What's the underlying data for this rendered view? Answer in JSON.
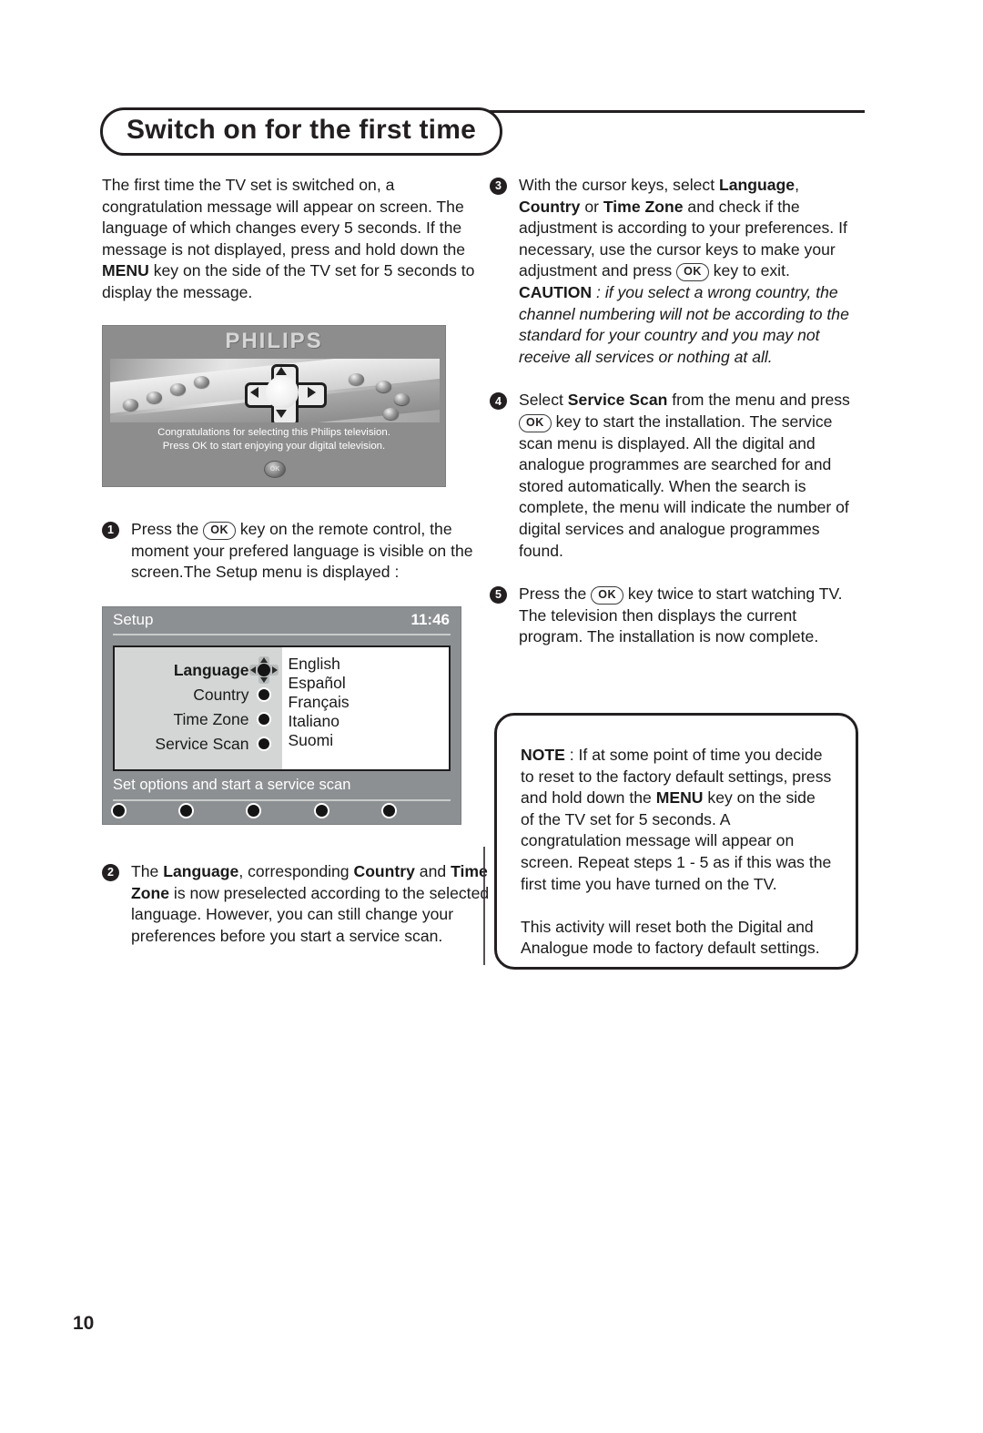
{
  "page": {
    "title": "Switch on for the first time",
    "number": "10"
  },
  "left_column": {
    "intro": "The first time the TV set is switched on, a congratulation message will appear on screen. The language of which changes every 5 seconds. If the message is not displayed, press and hold down the MENU key on the side of the TV set for 5 seconds to display the message.",
    "intro_parts": {
      "p1": "The first time the TV set is switched on, a congratulation message will appear on screen. The language of which changes every 5 seconds. If the message is not displayed, press and hold down the ",
      "menu_bold": "MENU",
      "p2": " key on the side of the TV set for 5 seconds to display the message."
    },
    "tv_image": {
      "brand": "PHILIPS",
      "message_line1": "Congratulations for selecting this Philips television.",
      "message_line2": "Press OK to start enjoying your digital television.",
      "ok_badge": "OK"
    },
    "step1": {
      "number": "1",
      "text_before": "Press the ",
      "ok_key": "OK",
      "text_after": " key on the remote control, the moment your prefered language is visible on the screen.The Setup menu is displayed :"
    },
    "setup_menu": {
      "title": "Setup",
      "time": "11:46",
      "items": [
        {
          "label": "Language",
          "selected": true
        },
        {
          "label": "Country",
          "selected": false
        },
        {
          "label": "Time Zone",
          "selected": false
        },
        {
          "label": "Service Scan",
          "selected": false
        }
      ],
      "languages": [
        "English",
        "Español",
        "Français",
        "Italiano",
        "Suomi"
      ],
      "footer_text": "Set options and start a service scan",
      "footer_dots": 5
    },
    "step2": {
      "number": "2",
      "seg1": "The ",
      "bold1": "Language",
      "seg2": ", corresponding ",
      "bold2": "Country",
      "seg3": " and ",
      "bold3": "Time Zone",
      "seg4": " is now preselected according to the selected language. However, you can still change your preferences before you start a service scan."
    }
  },
  "right_column": {
    "step3": {
      "number": "3",
      "seg1": "With the cursor keys, select ",
      "bold1": "Language",
      "seg2": ", ",
      "bold2": "Country",
      "seg3": " or ",
      "bold3": "Time Zone",
      "seg4": " and check if the adjustment is according to your preferences. If necessary, use the cursor keys to make your adjustment and press ",
      "ok_key": "OK",
      "seg5": " key to exit.",
      "caution_label": "CAUTION",
      "caution_text": " : if you select a wrong country, the channel numbering will not be according to the standard for your country and you may not receive all services or nothing at all."
    },
    "step4": {
      "number": "4",
      "seg1": "Select ",
      "bold1": "Service Scan",
      "seg2": " from the menu and press ",
      "ok_key": "OK",
      "seg3": " key to start the installation. The service scan menu is displayed. All the digital and analogue programmes are searched for and stored automatically. When the search is complete, the menu will indicate the number of digital services and analogue programmes found."
    },
    "step5": {
      "number": "5",
      "seg1": "Press the ",
      "ok_key": "OK",
      "seg2": " key twice to start watching TV. The television then displays the current program. The installation is now complete."
    },
    "note_box": {
      "label": "NOTE",
      "seg1": " : If at some point of time you decide to reset to the factory default settings, press and hold down the ",
      "bold_menu": "MENU",
      "seg2": " key on the side of the TV set for 5 seconds. A congratulation message will appear on screen. Repeat steps 1 - 5 as if this was the first time you have turned on the TV.",
      "paragraph2": "This activity will reset both the Digital and Analogue mode to factory default settings."
    }
  },
  "colors": {
    "ink": "#231f20",
    "menu_bar": "#8d9093",
    "menu_panel_left": "#d4d6d6",
    "tv_background": "#8d8d8d"
  }
}
